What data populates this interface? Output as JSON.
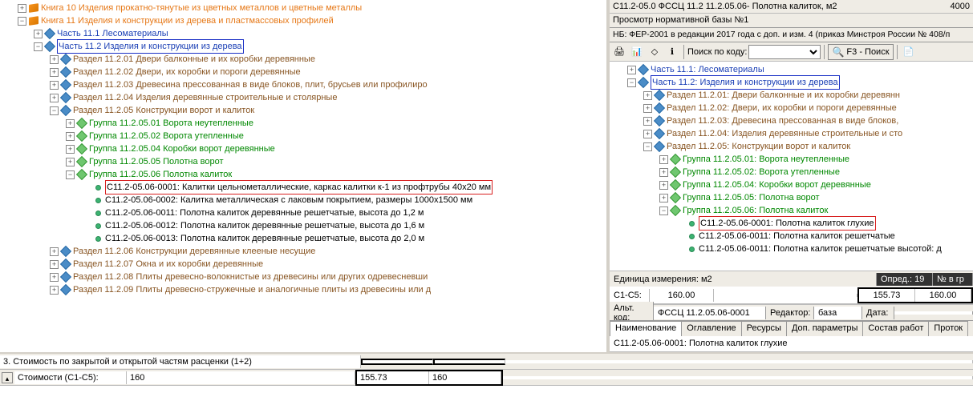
{
  "left_tree": {
    "kniga10": "Книга 10 Изделия прокатно-тянутые из цветных металлов и цветные металлы",
    "kniga11": "Книга 11 Изделия и конструкции из дерева и пластмассовых профилей",
    "chast11_1": "Часть 11.1 Лесоматериалы",
    "chast11_2": "Часть 11.2 Изделия и конструкции из дерева",
    "r11_2_01": "Раздел 11.2.01 Двери балконные и их коробки деревянные",
    "r11_2_02": "Раздел 11.2.02 Двери, их коробки и пороги деревянные",
    "r11_2_03": "Раздел 11.2.03 Древесина прессованная в виде блоков, плит, брусьев или профилиро",
    "r11_2_04": "Раздел 11.2.04 Изделия деревянные строительные и столярные",
    "r11_2_05": "Раздел 11.2.05 Конструкции ворот и калиток",
    "g11_2_05_01": "Группа 11.2.05.01 Ворота неутепленные",
    "g11_2_05_02": "Группа 11.2.05.02 Ворота утепленные",
    "g11_2_05_04": "Группа 11.2.05.04 Коробки ворот деревянные",
    "g11_2_05_05": "Группа 11.2.05.05 Полотна ворот",
    "g11_2_05_06": "Группа 11.2.05.06 Полотна калиток",
    "item_0001": "С11.2-05.06-0001: Калитки цельнометаллические, каркас калитки к-1 из профтрубы 40х20 мм",
    "item_0002": "С11.2-05.06-0002: Калитка металлическая с лаковым покрытием, размеры 1000х1500 мм",
    "item_0011": "С11.2-05.06-0011: Полотна калиток деревянные решетчатые, высота до 1,2 м",
    "item_0012": "С11.2-05.06-0012: Полотна калиток деревянные решетчатые, высота до 1,6 м",
    "item_0013": "С11.2-05.06-0013: Полотна калиток деревянные решетчатые, высота до 2,0 м",
    "r11_2_06": "Раздел 11.2.06 Конструкции деревянные клееные несущие",
    "r11_2_07": "Раздел 11.2.07 Окна и их коробки деревянные",
    "r11_2_08": "Раздел 11.2.08 Плиты древесно-волокнистые из древесины или других одревесневши",
    "r11_2_09": "Раздел 11.2.09 Плиты древесно-стружечные и аналогичные плиты из древесины или д"
  },
  "bottom_left": {
    "row3_label": "3. Стоимость по закрытой и открытой частям расценки (1+2)",
    "stoimosti_label": "Стоимости (С1-С5):",
    "v1": "160",
    "v2": "155.73",
    "v3": "160"
  },
  "right": {
    "top_code": "C11.2-05.0 ФССЦ 11.2 11.2.05.06- Полотна калиток, м2",
    "top_val": "4000",
    "viewer_title": "Просмотр нормативной базы №1",
    "nb_line": "НБ:  ФЕР-2001 в редакции 2017 года с доп. и изм. 4 (приказ Минстроя России № 408/п",
    "search_label": "Поиск по коду:",
    "f3_label": "F3 - Поиск",
    "tree": {
      "chast11_1": "Часть 11.1: Лесоматериалы",
      "chast11_2": "Часть 11.2: Изделия и конструкции из дерева",
      "r01": "Раздел 11.2.01: Двери балконные и их коробки деревянн",
      "r02": "Раздел 11.2.02: Двери, их коробки и пороги деревянные",
      "r03": "Раздел 11.2.03: Древесина прессованная в виде блоков,",
      "r04": "Раздел 11.2.04: Изделия деревянные строительные и сто",
      "r05": "Раздел 11.2.05: Конструкции ворот и калиток",
      "g01": "Группа 11.2.05.01: Ворота неутепленные",
      "g02": "Группа 11.2.05.02: Ворота утепленные",
      "g04": "Группа 11.2.05.04: Коробки ворот деревянные",
      "g05": "Группа 11.2.05.05: Полотна ворот",
      "g06": "Группа 11.2.05.06: Полотна калиток",
      "i0001": "С11.2-05.06-0001: Полотна калиток глухие",
      "i0011_a": "С11.2-05.06-0011: Полотна калиток решетчатые",
      "i0011_b": "С11.2-05.06-0011: Полотна калиток решетчатые высотой: д"
    },
    "unit_label": "Единица измерения: м2",
    "opred_label": "Опред.: 19",
    "nv_label": "№ в гр",
    "c1c5": "С1-С5:",
    "val160a": "160.00",
    "val15573": "155.73",
    "val160b": "160.00",
    "alt_label": "Альт. код:",
    "alt_val": "ФССЦ 11.2.05.06-0001",
    "red_label": "Редактор:",
    "red_val": "база",
    "data_label": "Дата:",
    "tabs": {
      "t1": "Наименование",
      "t2": "Оглавление",
      "t3": "Ресурсы",
      "t4": "Доп. параметры",
      "t5": "Состав работ",
      "t6": "Проток"
    },
    "detail_line": "С11.2-05.06-0001: Полотна калиток глухие"
  }
}
